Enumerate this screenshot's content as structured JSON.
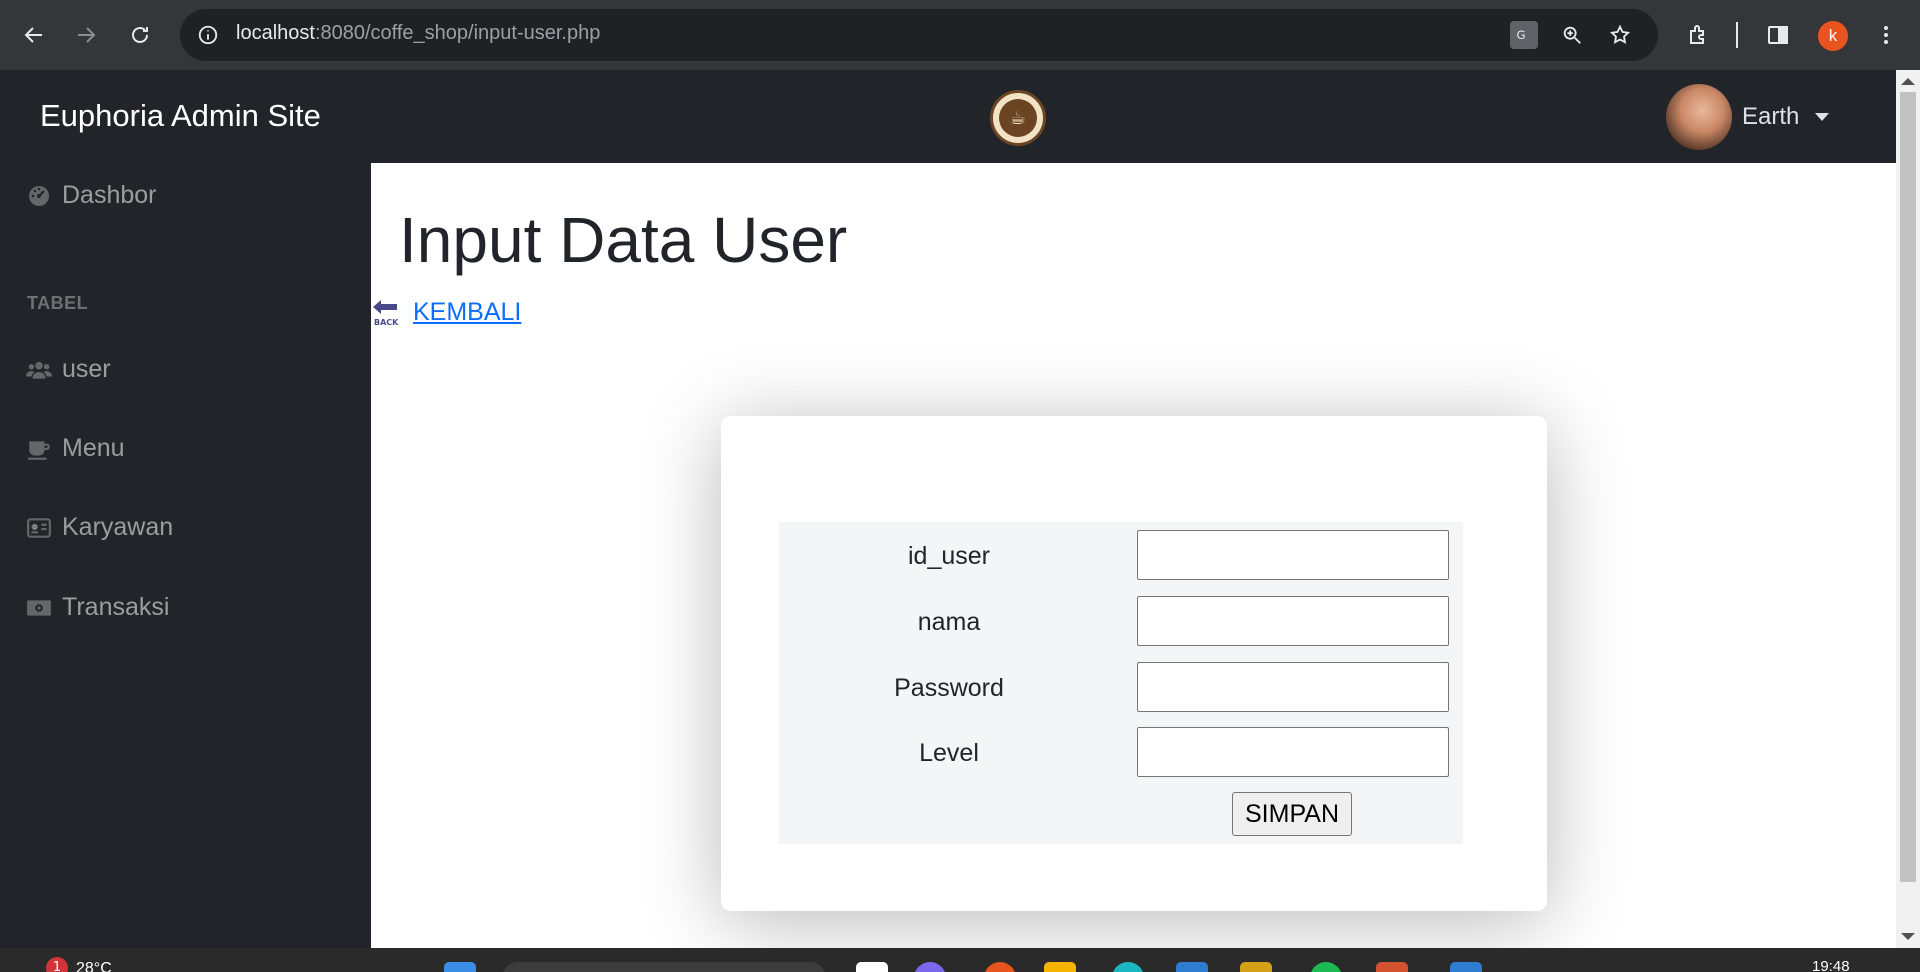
{
  "browser": {
    "url_host": "localhost",
    "url_path": ":8080/coffe_shop/input-user.php",
    "profile_initial": "k"
  },
  "header": {
    "brand": "Euphoria Admin Site",
    "user_name": "Earth"
  },
  "sidebar": {
    "items": [
      {
        "label": "Dashbor",
        "icon": "dashboard-gauge-icon"
      },
      {
        "label": "user",
        "icon": "users-icon"
      },
      {
        "label": "Menu",
        "icon": "coffee-cup-icon"
      },
      {
        "label": "Karyawan",
        "icon": "id-card-icon"
      },
      {
        "label": "Transaksi",
        "icon": "money-bill-icon"
      }
    ],
    "heading": "TABEL"
  },
  "main": {
    "title": "Input Data User",
    "back_link": "KEMBALI",
    "back_icon_text": "BACK",
    "form": {
      "fields": [
        {
          "label": "id_user",
          "value": ""
        },
        {
          "label": "nama",
          "value": ""
        },
        {
          "label": "Password",
          "value": ""
        },
        {
          "label": "Level",
          "value": ""
        }
      ],
      "submit_label": "SIMPAN"
    }
  },
  "taskbar": {
    "weather": "28°C",
    "notification_count": "1",
    "time": "19:48"
  },
  "colors": {
    "sidebar_bg": "#212529",
    "link": "#0d6efd",
    "profile": "#e8541e"
  }
}
